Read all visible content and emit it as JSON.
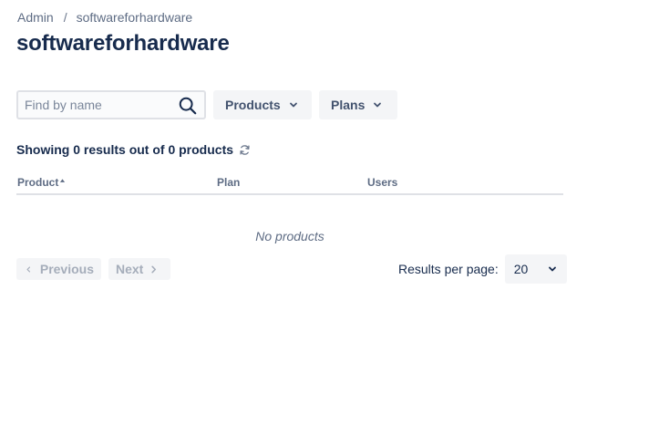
{
  "breadcrumb": {
    "items": [
      {
        "label": "Admin"
      },
      {
        "label": "softwareforhardware"
      }
    ],
    "separator": "/"
  },
  "page_title": "softwareforhardware",
  "filters": {
    "search_placeholder": "Find by name",
    "search_value": "",
    "search_icon": "search-icon",
    "products_label": "Products",
    "plans_label": "Plans"
  },
  "summary": {
    "text": "Showing 0 results out of 0 products",
    "refresh_icon": "refresh-icon"
  },
  "table": {
    "columns": [
      {
        "label": "Product",
        "sorted": "asc"
      },
      {
        "label": "Plan"
      },
      {
        "label": "Users"
      }
    ],
    "rows": [],
    "empty_text": "No products"
  },
  "pagination": {
    "previous_label": "Previous",
    "next_label": "Next",
    "previous_enabled": false,
    "next_enabled": false,
    "results_per_page_label": "Results per page:",
    "results_per_page_value": "20"
  },
  "colors": {
    "text_primary": "#172b4d",
    "text_secondary": "#5e6c84",
    "button_bg": "#f4f5f7",
    "disabled_text": "#a5adba",
    "border": "#dfe1e6"
  }
}
